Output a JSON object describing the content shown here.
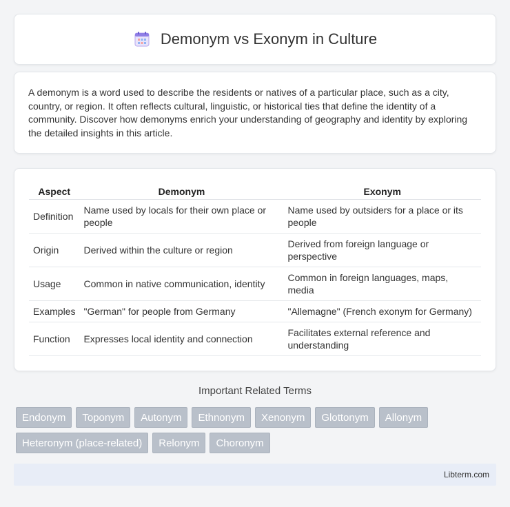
{
  "header": {
    "title": "Demonym vs Exonym in Culture",
    "icon": "calendar-icon"
  },
  "intro": {
    "text": "A demonym is a word used to describe the residents or natives of a particular place, such as a city, country, or region. It often reflects cultural, linguistic, or historical ties that define the identity of a community. Discover how demonyms enrich your understanding of geography and identity by exploring the detailed insights in this article."
  },
  "table": {
    "headers": [
      "Aspect",
      "Demonym",
      "Exonym"
    ],
    "rows": [
      [
        "Definition",
        "Name used by locals for their own place or people",
        "Name used by outsiders for a place or its people"
      ],
      [
        "Origin",
        "Derived within the culture or region",
        "Derived from foreign language or perspective"
      ],
      [
        "Usage",
        "Common in native communication, identity",
        "Common in foreign languages, maps, media"
      ],
      [
        "Examples",
        "\"German\" for people from Germany",
        "\"Allemagne\" (French exonym for Germany)"
      ],
      [
        "Function",
        "Expresses local identity and connection",
        "Facilitates external reference and understanding"
      ]
    ]
  },
  "related": {
    "title": "Important Related Terms",
    "tags": [
      "Endonym",
      "Toponym",
      "Autonym",
      "Ethnonym",
      "Xenonym",
      "Glottonym",
      "Allonym",
      "Heteronym (place-related)",
      "Relonym",
      "Choronym"
    ]
  },
  "footer": {
    "text": "Libterm.com"
  }
}
